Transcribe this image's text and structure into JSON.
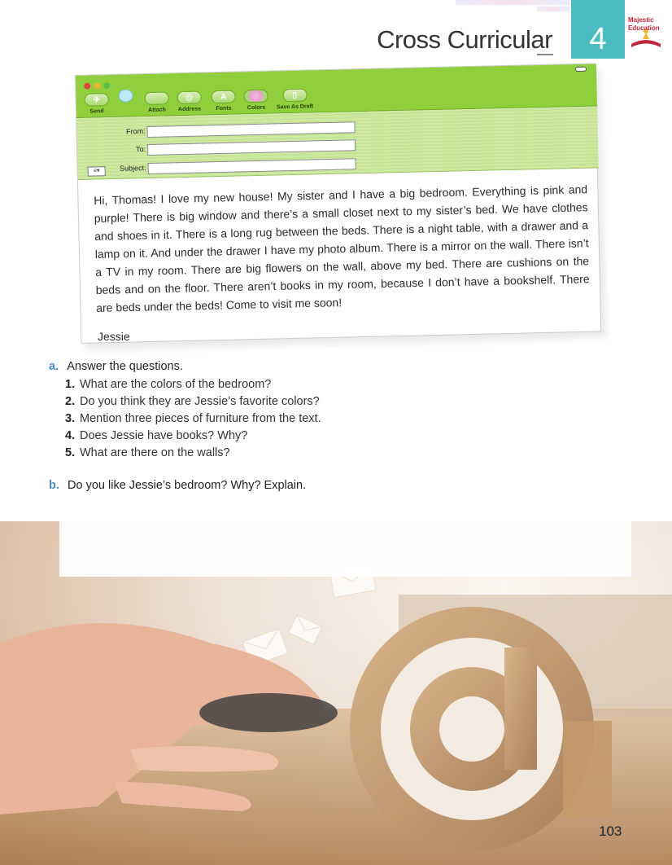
{
  "header": {
    "title": "Cross Curricular",
    "unit_number": "4",
    "logo_text_line1": "Majestic",
    "logo_text_line2": "Education"
  },
  "mail": {
    "toolbar": {
      "send": "Send",
      "attach": "Attach",
      "address": "Address",
      "fonts": "Fonts",
      "colors": "Colors",
      "save_draft": "Save As Draft"
    },
    "fields": {
      "from_label": "From:",
      "to_label": "To:",
      "subject_label": "Subject:",
      "from_value": "",
      "to_value": "",
      "subject_value": ""
    },
    "body": "Hi, Thomas! I love my new house! My sister and I have a big bedroom. Everything is pink and purple! There is big window and there’s a small closet next to my sister’s bed. We have clothes and shoes in it. There is a long rug between the beds. There is a night table, with a drawer and a lamp on it. And under the drawer I have my photo album. There is a mirror on the wall. There isn’t a TV in my room. There are big flowers on the wall, above my bed. There are cushions on the beds and on the floor. There aren’t books in my room, because I don’t have a bookshelf. There are beds under the beds! Come to visit me soon!",
    "signature": "Jessie"
  },
  "exercise_a": {
    "letter": "a.",
    "title": "Answer the questions.",
    "questions": [
      {
        "num": "1.",
        "text": "What are the colors of the bedroom?"
      },
      {
        "num": "2.",
        "text": "Do you think they are Jessie’s favorite colors?"
      },
      {
        "num": "3.",
        "text": "Mention three pieces of furniture from the text."
      },
      {
        "num": "4.",
        "text": "Does Jessie have books? Why?"
      },
      {
        "num": "5.",
        "text": "What are there on the walls?"
      }
    ]
  },
  "exercise_b": {
    "letter": "b.",
    "title": "Do you like Jessie’s bedroom? Why? Explain."
  },
  "page_number": "103",
  "colors": {
    "accent_teal": "#4bbcc1",
    "mail_green": "#8fcf3c",
    "question_blue": "#4e8bc7"
  }
}
